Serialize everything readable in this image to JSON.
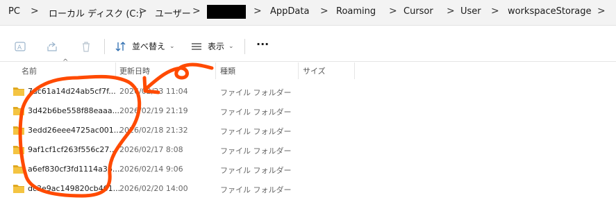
{
  "breadcrumb": {
    "items": [
      "PC",
      "ローカル ディスク (C:)",
      "ユーザー",
      "AppData",
      "Roaming",
      "Cursor",
      "User",
      "workspaceStorage"
    ],
    "separator": ">"
  },
  "toolbar": {
    "sort_label": "並べ替え",
    "view_label": "表示",
    "more_label": "···",
    "icons": [
      "rename-icon",
      "share-icon",
      "delete-icon",
      "sort-icon",
      "view-icon"
    ]
  },
  "columns": {
    "name": "名前",
    "modified": "更新日時",
    "type": "種類",
    "size": "サイズ"
  },
  "files": [
    {
      "name": "7ac61a14d24ab5cf7f...",
      "modified": "2026/02/23 11:04",
      "type": "ファイル フォルダー"
    },
    {
      "name": "3d42b6be558f88eaaa...",
      "modified": "2026/02/19 21:19",
      "type": "ファイル フォルダー"
    },
    {
      "name": "3edd26eee4725ac001...",
      "modified": "2026/02/18 21:32",
      "type": "ファイル フォルダー"
    },
    {
      "name": "9af1cf1cf263f556c27...",
      "modified": "2026/02/17 8:08",
      "type": "ファイル フォルダー"
    },
    {
      "name": "a6ef830cf3fd1114a36...",
      "modified": "2026/02/14 9:06",
      "type": "ファイル フォルダー"
    },
    {
      "name": "dc3e9ac149820cb461...",
      "modified": "2026/02/20 14:00",
      "type": "ファイル フォルダー"
    }
  ],
  "colors": {
    "annotation": "#ff4a00",
    "folder": "#f4c442",
    "folder_dark": "#e0a820"
  }
}
